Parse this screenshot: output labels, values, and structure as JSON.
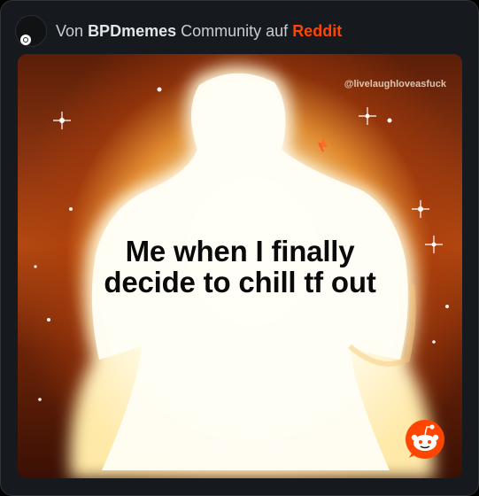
{
  "header": {
    "prefix": "Von",
    "community": "BPDmemes",
    "middle": "Community auf",
    "brand": "Reddit",
    "avatar_icon": "reddit-alien-icon"
  },
  "media": {
    "watermark": "@livelaughloveasfuck",
    "caption_line1": "Me when I finally",
    "caption_line2": "decide to chill tf out",
    "badge_icon": "reddit-snoo-icon"
  },
  "colors": {
    "background": "#16191d",
    "brand": "#ff4500",
    "text": "#c9cdd1"
  }
}
